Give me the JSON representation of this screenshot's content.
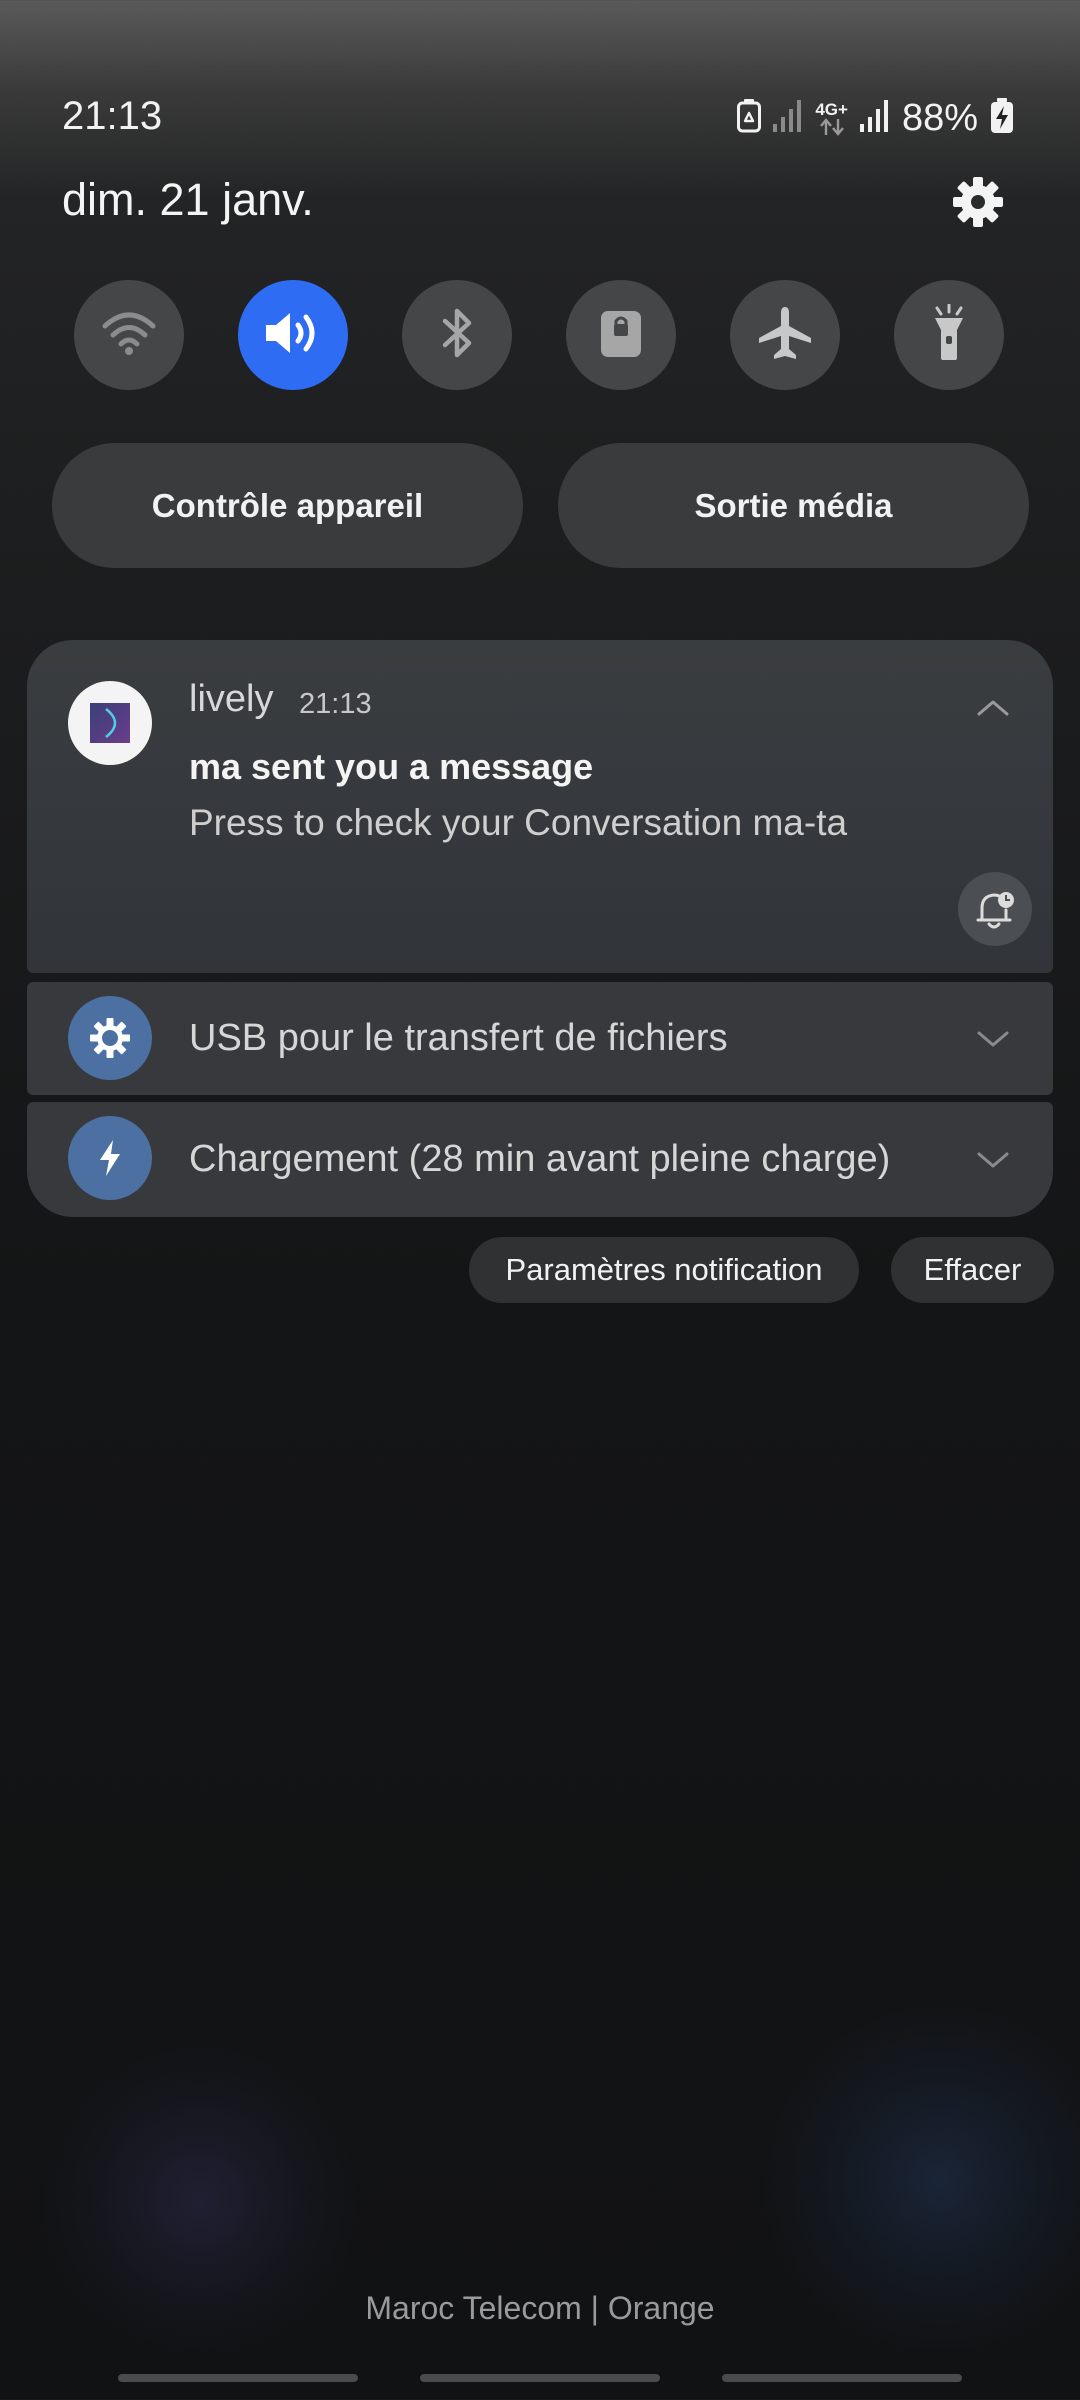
{
  "status_bar": {
    "time": "21:13",
    "network_type": "4G+",
    "battery_percent": "88%",
    "icons": [
      "recycle-battery-icon",
      "signal-icon",
      "4g-plus-icon",
      "signal-icon",
      "battery-charging-icon"
    ]
  },
  "header": {
    "date": "dim. 21 janv.",
    "settings_icon": "gear-icon"
  },
  "quick_settings": {
    "tiles": [
      {
        "name": "wifi",
        "icon": "wifi-icon",
        "active": false
      },
      {
        "name": "sound",
        "icon": "speaker-icon",
        "active": true
      },
      {
        "name": "bluetooth",
        "icon": "bluetooth-icon",
        "active": false
      },
      {
        "name": "rotation-lock",
        "icon": "lock-icon",
        "active": false
      },
      {
        "name": "airplane-mode",
        "icon": "airplane-icon",
        "active": false
      },
      {
        "name": "flashlight",
        "icon": "flashlight-icon",
        "active": false
      }
    ],
    "accent_color": "#2f6cf4"
  },
  "panels": {
    "device_control": "Contrôle appareil",
    "media_output": "Sortie média"
  },
  "notifications": [
    {
      "app": "lively",
      "time": "21:13",
      "title": "ma sent you a message",
      "body": "Press to check your Conversation ma-ta",
      "expanded": true
    },
    {
      "text": "USB pour le transfert de fichiers",
      "icon": "usb-settings-icon"
    },
    {
      "text": "Chargement (28 min avant pleine charge)",
      "icon": "lightning-icon"
    }
  ],
  "actions": {
    "notification_settings": "Paramètres notification",
    "clear": "Effacer"
  },
  "footer": {
    "carrier": "Maroc Telecom | Orange"
  }
}
